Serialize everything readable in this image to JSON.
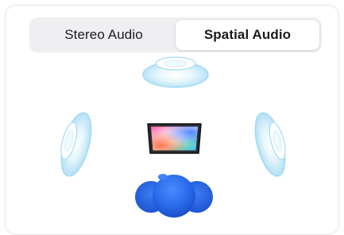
{
  "segmented_control": {
    "options": [
      {
        "label": "Stereo Audio",
        "selected": false
      },
      {
        "label": "Spatial Audio",
        "selected": true
      }
    ]
  },
  "illustration": {
    "icons": [
      "speaker-top-icon",
      "speaker-left-icon",
      "speaker-right-icon",
      "ipad-screen-icon",
      "listener-head-icon"
    ],
    "colors": {
      "speaker_ring": "#b6e2f6",
      "speaker_glow": "#d9f1fb",
      "head_blue": "#2a6bea",
      "head_dark": "#1e55cf"
    }
  }
}
